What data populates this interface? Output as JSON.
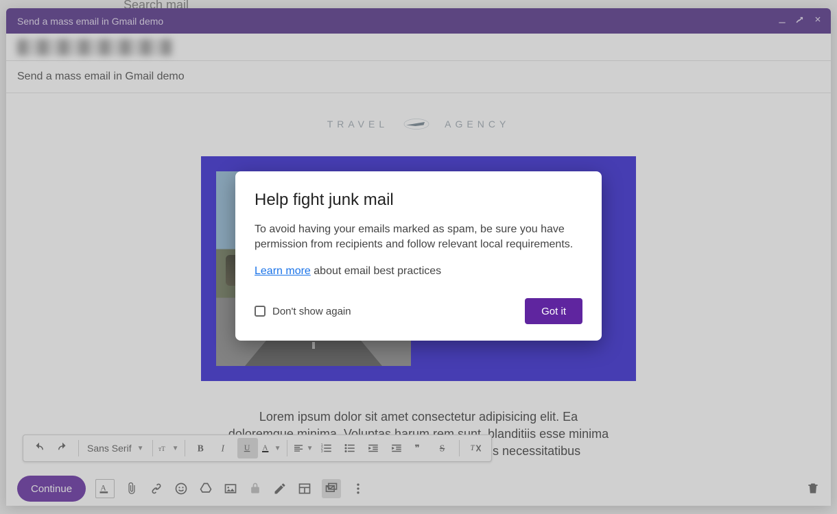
{
  "background": {
    "search_placeholder": "Search mail"
  },
  "compose": {
    "title": "Send a mass email in Gmail demo",
    "subject": "Send a mass email in Gmail demo",
    "send_label": "Continue"
  },
  "email_body": {
    "brand_left": "TRAVEL",
    "brand_right": "AGENCY",
    "paragraph": "Lorem ipsum dolor sit amet consectetur adipisicing elit. Ea doloremque minima. Voluptas harum rem sunt, blanditiis esse minima velit suscipit aliquid? Quaerat necessitatibus necessitatibus"
  },
  "format_toolbar": {
    "font_label": "Sans Serif"
  },
  "dialog": {
    "title": "Help fight junk mail",
    "body": "To avoid having your emails marked as spam, be sure you have permission from recipients and follow relevant local requirements.",
    "learn_more": "Learn more",
    "learn_more_suffix": " about email best practices",
    "dont_show": "Don't show again",
    "ok_label": "Got it"
  }
}
